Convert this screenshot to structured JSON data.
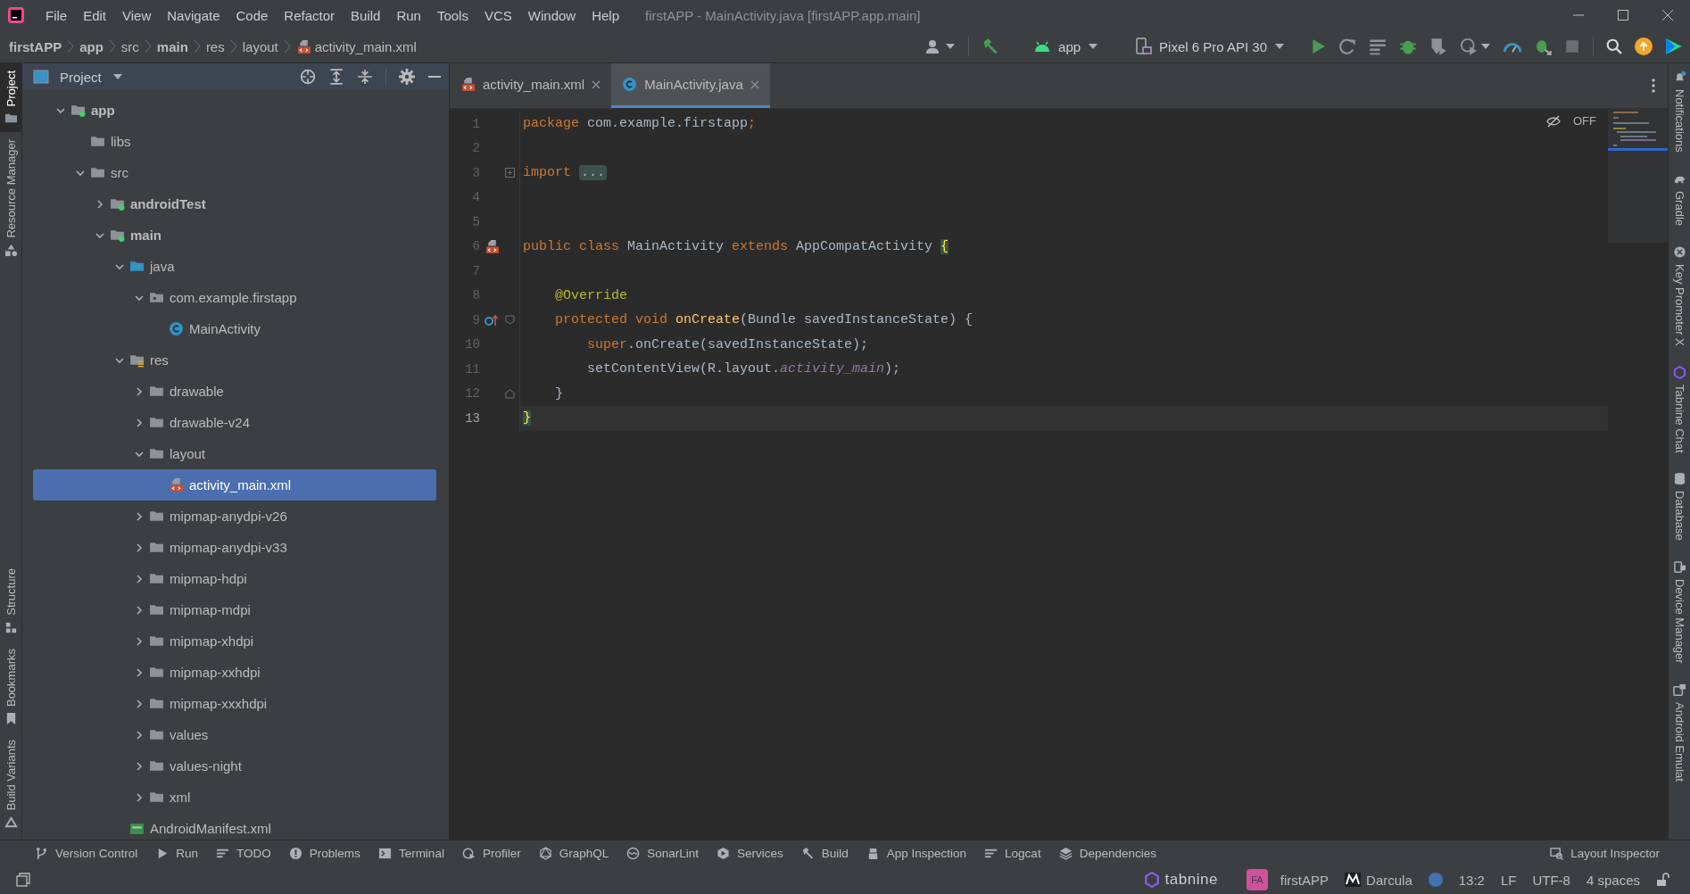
{
  "window": {
    "title": "firstAPP - MainActivity.java [firstAPP.app.main]"
  },
  "menu": [
    "File",
    "Edit",
    "View",
    "Navigate",
    "Code",
    "Refactor",
    "Build",
    "Run",
    "Tools",
    "VCS",
    "Window",
    "Help"
  ],
  "breadcrumbs": [
    {
      "label": "firstAPP",
      "kind": "module"
    },
    {
      "label": "app",
      "kind": "module"
    },
    {
      "label": "src",
      "kind": "folder"
    },
    {
      "label": "main",
      "kind": "module"
    },
    {
      "label": "res",
      "kind": "folder"
    },
    {
      "label": "layout",
      "kind": "folder"
    },
    {
      "label": "activity_main.xml",
      "kind": "layout-file"
    }
  ],
  "run_toolbar": {
    "configuration": "app",
    "device": "Pixel 6 Pro API 30"
  },
  "left_tool_windows_top": [
    {
      "label": "Project",
      "kind": "folder",
      "selected": true
    },
    {
      "label": "Resource Manager",
      "kind": "shapes",
      "selected": false
    }
  ],
  "left_tool_windows_bottom": [
    {
      "label": "Structure",
      "kind": "structure",
      "selected": false
    },
    {
      "label": "Bookmarks",
      "kind": "bookmark",
      "selected": false
    },
    {
      "label": "Build Variants",
      "kind": "variants",
      "selected": false
    }
  ],
  "project_panel": {
    "title": "Project",
    "tree": [
      {
        "label": "app",
        "kind": "module",
        "selected": false,
        "expanded": true,
        "children": [
          {
            "label": "libs",
            "kind": "folder",
            "selected": false
          },
          {
            "label": "src",
            "kind": "folder",
            "selected": false,
            "expanded": true,
            "children": [
              {
                "label": "androidTest",
                "kind": "module",
                "selected": false,
                "expanded": false
              },
              {
                "label": "main",
                "kind": "module",
                "selected": false,
                "expanded": true,
                "children": [
                  {
                    "label": "java",
                    "kind": "source-root",
                    "selected": false,
                    "expanded": true,
                    "children": [
                      {
                        "label": "com.example.firstapp",
                        "kind": "package",
                        "selected": false,
                        "expanded": true,
                        "children": [
                          {
                            "label": "MainActivity",
                            "kind": "class",
                            "selected": false
                          }
                        ]
                      }
                    ]
                  },
                  {
                    "label": "res",
                    "kind": "res-root",
                    "selected": false,
                    "expanded": true,
                    "children": [
                      {
                        "label": "drawable",
                        "kind": "folder",
                        "selected": false,
                        "expanded": false
                      },
                      {
                        "label": "drawable-v24",
                        "kind": "folder",
                        "selected": false,
                        "expanded": false
                      },
                      {
                        "label": "layout",
                        "kind": "folder",
                        "selected": false,
                        "expanded": true,
                        "children": [
                          {
                            "label": "activity_main.xml",
                            "kind": "layout-file",
                            "selected": true
                          }
                        ]
                      },
                      {
                        "label": "mipmap-anydpi-v26",
                        "kind": "folder",
                        "selected": false,
                        "expanded": false
                      },
                      {
                        "label": "mipmap-anydpi-v33",
                        "kind": "folder",
                        "selected": false,
                        "expanded": false
                      },
                      {
                        "label": "mipmap-hdpi",
                        "kind": "folder",
                        "selected": false,
                        "expanded": false
                      },
                      {
                        "label": "mipmap-mdpi",
                        "kind": "folder",
                        "selected": false,
                        "expanded": false
                      },
                      {
                        "label": "mipmap-xhdpi",
                        "kind": "folder",
                        "selected": false,
                        "expanded": false
                      },
                      {
                        "label": "mipmap-xxhdpi",
                        "kind": "folder",
                        "selected": false,
                        "expanded": false
                      },
                      {
                        "label": "mipmap-xxxhdpi",
                        "kind": "folder",
                        "selected": false,
                        "expanded": false
                      },
                      {
                        "label": "values",
                        "kind": "folder",
                        "selected": false,
                        "expanded": false
                      },
                      {
                        "label": "values-night",
                        "kind": "folder",
                        "selected": false,
                        "expanded": false
                      },
                      {
                        "label": "xml",
                        "kind": "folder",
                        "selected": false,
                        "expanded": false
                      }
                    ]
                  },
                  {
                    "label": "AndroidManifest.xml",
                    "kind": "manifest",
                    "selected": false
                  }
                ]
              }
            ]
          }
        ]
      }
    ]
  },
  "editor": {
    "tabs": [
      {
        "label": "activity_main.xml",
        "kind": "layout-file",
        "selected": false
      },
      {
        "label": "MainActivity.java",
        "kind": "class",
        "selected": true
      }
    ],
    "indicator": "OFF",
    "lines": [
      {
        "number": "1",
        "current": false,
        "tokens": [
          {
            "text": "package ",
            "kind": "keyword"
          },
          {
            "text": "com.example.firstapp",
            "kind": "plain"
          },
          {
            "text": ";",
            "kind": "keyword"
          }
        ]
      },
      {
        "number": "2",
        "current": false
      },
      {
        "number": "3",
        "current": false,
        "fold": {
          "kind": "collapsed"
        },
        "tokens": [
          {
            "text": "import ",
            "kind": "keyword"
          },
          {
            "text": "...",
            "kind": "fold"
          }
        ]
      },
      {
        "number": "4",
        "current": false
      },
      {
        "number": "5",
        "current": false
      },
      {
        "number": "6",
        "current": false,
        "marker": {
          "kind": "layout"
        },
        "tokens": [
          {
            "text": "public class ",
            "kind": "keyword"
          },
          {
            "text": "MainActivity ",
            "kind": "plain"
          },
          {
            "text": "extends ",
            "kind": "keyword"
          },
          {
            "text": "AppCompatActivity ",
            "kind": "plain"
          },
          {
            "text": "{",
            "kind": "brace-match"
          }
        ]
      },
      {
        "number": "7",
        "current": false
      },
      {
        "number": "8",
        "current": false,
        "tokens": [
          {
            "text": "    @Override",
            "kind": "annotation"
          }
        ]
      },
      {
        "number": "9",
        "current": false,
        "marker": {
          "kind": "override"
        },
        "fold": {
          "kind": "start"
        },
        "tokens": [
          {
            "text": "    protected void ",
            "kind": "keyword"
          },
          {
            "text": "onCreate",
            "kind": "method"
          },
          {
            "text": "(Bundle savedInstanceState) {",
            "kind": "plain"
          }
        ]
      },
      {
        "number": "10",
        "current": false,
        "tokens": [
          {
            "text": "        super",
            "kind": "keyword"
          },
          {
            "text": ".onCreate(savedInstanceState);",
            "kind": "plain"
          }
        ]
      },
      {
        "number": "11",
        "current": false,
        "tokens": [
          {
            "text": "        setContentView(R.layout.",
            "kind": "plain"
          },
          {
            "text": "activity_main",
            "kind": "static"
          },
          {
            "text": ");",
            "kind": "plain"
          }
        ]
      },
      {
        "number": "12",
        "current": false,
        "fold": {
          "kind": "end"
        },
        "tokens": [
          {
            "text": "    }",
            "kind": "plain"
          }
        ]
      },
      {
        "number": "13",
        "current": true,
        "tokens": [
          {
            "text": "}",
            "kind": "brace-match"
          }
        ]
      }
    ]
  },
  "right_tool_windows": [
    {
      "label": "Notifications",
      "kind": "bell"
    },
    {
      "label": "Gradle",
      "kind": "elephant"
    },
    {
      "label": "Key Promoter X",
      "kind": "keys"
    },
    {
      "label": "Tabnine Chat",
      "kind": "tabnine"
    },
    {
      "label": "Database",
      "kind": "database"
    },
    {
      "label": "Device Manager",
      "kind": "devices"
    },
    {
      "label": "Android Emulat",
      "kind": "emulator"
    }
  ],
  "bottom_tool_windows": [
    {
      "label": "Version Control",
      "kind": "vcs"
    },
    {
      "label": "Run",
      "kind": "run"
    },
    {
      "label": "TODO",
      "kind": "list"
    },
    {
      "label": "Problems",
      "kind": "problems"
    },
    {
      "label": "Terminal",
      "kind": "terminal"
    },
    {
      "label": "Profiler",
      "kind": "profiler"
    },
    {
      "label": "GraphQL",
      "kind": "graphql"
    },
    {
      "label": "SonarLint",
      "kind": "sonar"
    },
    {
      "label": "Services",
      "kind": "services"
    },
    {
      "label": "Build",
      "kind": "hammer"
    },
    {
      "label": "App Inspection",
      "kind": "inspection"
    },
    {
      "label": "Logcat",
      "kind": "list"
    },
    {
      "label": "Dependencies",
      "kind": "layers"
    }
  ],
  "layout_inspector": "Layout Inspector",
  "status_bar": {
    "plugin": "tabnine",
    "project_badge": "FA",
    "project": "firstAPP",
    "theme": "Darcula",
    "position": "13:2",
    "line_separator": "LF",
    "encoding": "UTF-8",
    "indent": "4 spaces"
  }
}
